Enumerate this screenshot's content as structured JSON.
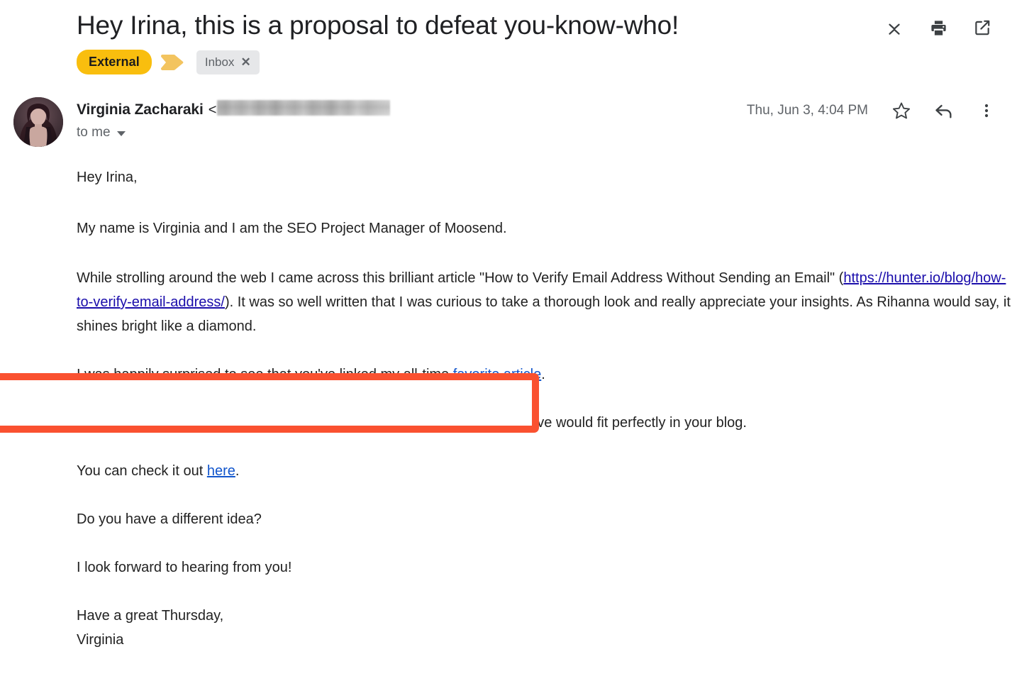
{
  "header": {
    "subject": "Hey Irina, this is a proposal to defeat you-know-who!",
    "actions": [
      {
        "name": "collapse-icon",
        "label": "Collapse all"
      },
      {
        "name": "print-icon",
        "label": "Print all"
      },
      {
        "name": "open-in-new-window-icon",
        "label": "Open in new window"
      }
    ],
    "badges": {
      "external_label": "External",
      "external_color": "#F9BE0E",
      "arrow_color": "#F3C45F",
      "inbox_label": "Inbox",
      "inbox_close": "✕",
      "inbox_bg": "#E6E7E9"
    }
  },
  "sender": {
    "name": "Virginia Zacharaki",
    "bracket_open": "<",
    "email_redacted": true,
    "recipients_label": "to me",
    "timestamp": "Thu, Jun 3, 4:04 PM",
    "actions": [
      {
        "name": "star-icon",
        "label": "Star"
      },
      {
        "name": "reply-icon",
        "label": "Reply"
      },
      {
        "name": "more-options-icon",
        "label": "More"
      }
    ]
  },
  "message": {
    "greeting": "Hey Irina,",
    "highlighted": "My name is Virginia and I am the SEO Project Manager of Moosend.",
    "highlight_color": "#FA5130",
    "p_article_1": "While strolling around the web I came across this brilliant article \"How to Verify Email Address Without Sending an Email\" (",
    "link_url": "https://hunter.io/blog/how-to-verify-email-address/",
    "p_article_2": "). It was so well written that I was curious to take a thorough look and really appreciate your insights. As Rihanna would say, it shines bright like a diamond.",
    "p_linked_1": "I was happily surprised to see that you've linked my all-time ",
    "link_favorite": "favorite article",
    "p_linked_2": ".",
    "p_team": "My team has also produced an in-depth and up-to-date article, that I believe would fit perfectly in your blog.",
    "p_check_1": "You can check it out ",
    "link_here": "here",
    "p_check_2": ".",
    "p_idea": "Do you have a different idea?",
    "p_forward": "I look forward to hearing from you!",
    "signoff": "Have a great Thursday,",
    "signature": "Virginia"
  }
}
